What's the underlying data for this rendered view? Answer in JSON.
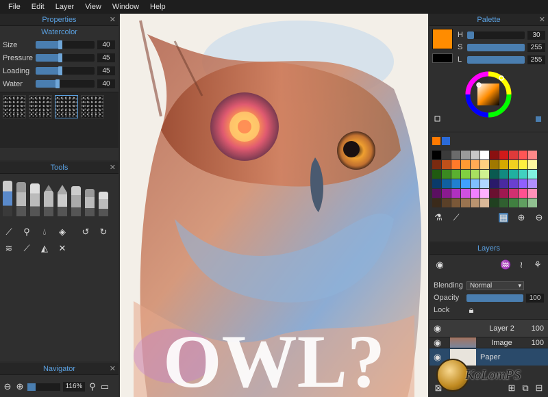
{
  "menu": [
    "File",
    "Edit",
    "Layer",
    "View",
    "Window",
    "Help"
  ],
  "properties": {
    "title": "Properties",
    "brush_name": "Watercolor",
    "sliders": [
      {
        "label": "Size",
        "value": "40",
        "fraction": 0.45
      },
      {
        "label": "Pressure",
        "value": "45",
        "fraction": 0.45
      },
      {
        "label": "Loading",
        "value": "45",
        "fraction": 0.45
      },
      {
        "label": "Water",
        "value": "40",
        "fraction": 0.4
      }
    ]
  },
  "tools": {
    "title": "Tools"
  },
  "navigator": {
    "title": "Navigator",
    "zoom": "116%",
    "zoom_fraction": 0.26
  },
  "palette": {
    "title": "Palette",
    "hsl": [
      {
        "key": "H",
        "value": "30",
        "fraction": 0.12
      },
      {
        "key": "S",
        "value": "255",
        "fraction": 1.0
      },
      {
        "key": "L",
        "value": "255",
        "fraction": 1.0
      }
    ],
    "primary_color": "#ff8c00",
    "secondary_color": "#000000"
  },
  "swatches": [
    "#000000",
    "#3a3a3a",
    "#6b6b6b",
    "#9a9a9a",
    "#c8c8c8",
    "#ffffff",
    "#8a1010",
    "#d11a1a",
    "#e03a3a",
    "#ff5555",
    "#ff8888",
    "#7a2a10",
    "#c0501a",
    "#ff7a2a",
    "#ff9a33",
    "#ffaa55",
    "#ffd080",
    "#a07800",
    "#d4a800",
    "#f0d020",
    "#fff040",
    "#fff8a0",
    "#205a10",
    "#3a8a20",
    "#5ab030",
    "#80d040",
    "#a8e060",
    "#d0f090",
    "#0a5a50",
    "#128a80",
    "#20b0a0",
    "#40d0c0",
    "#80f0e0",
    "#0a3a6a",
    "#1060a0",
    "#2080d0",
    "#40a0ff",
    "#80c0ff",
    "#b0d8ff",
    "#2a1a6a",
    "#4a2aa0",
    "#6a40d0",
    "#9060ff",
    "#b090ff",
    "#5a1060",
    "#8a1a90",
    "#b030c0",
    "#d050e0",
    "#f080ff",
    "#ffb0ff",
    "#6a1030",
    "#a01850",
    "#d03070",
    "#ff5090",
    "#ff90b8",
    "#3a2a1a",
    "#5a4028",
    "#7a5838",
    "#9a7450",
    "#ba9470",
    "#dab898",
    "#204020",
    "#306030",
    "#408040",
    "#60a060",
    "#90c090"
  ],
  "layers": {
    "title": "Layers",
    "blending_label": "Blending",
    "blending_value": "Normal",
    "opacity_label": "Opacity",
    "opacity_value": "100",
    "lock_label": "Lock",
    "items": [
      {
        "name": "Layer 2",
        "opacity": "100"
      },
      {
        "name": "Image",
        "opacity": "100"
      },
      {
        "name": "Paper",
        "opacity": ""
      }
    ]
  },
  "canvas_text": "OWL?",
  "watermark": "KoLomPS",
  "colors": {
    "accent": "#5aa0e0",
    "panel": "#2f2f2f"
  }
}
